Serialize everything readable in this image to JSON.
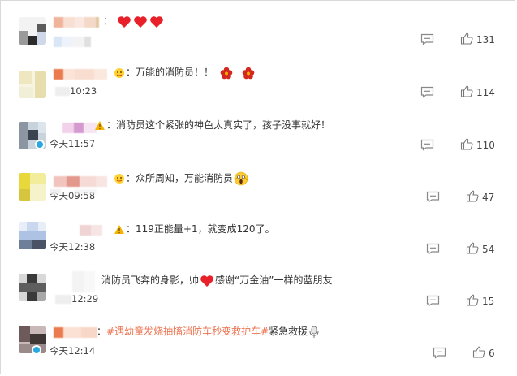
{
  "comments": [
    {
      "id": 1,
      "text_prefix": "：",
      "emojis": "heart-x3",
      "time": "",
      "likes": "131"
    },
    {
      "id": 2,
      "text": "：万能的消防员！！",
      "time": "10:23",
      "likes": "114"
    },
    {
      "id": 3,
      "text": "：消防员这个紧张的神色太真实了，孩子没事就好！",
      "time": "今天11:57",
      "likes": "110"
    },
    {
      "id": 4,
      "text": "：众所周知，万能消防员",
      "time": "今天09:58",
      "likes": "47"
    },
    {
      "id": 5,
      "text": "：119正能量+1，就变成120了。",
      "time": "今天12:38",
      "likes": "54"
    },
    {
      "id": 6,
      "text_a": "消防员飞奔的身影，帅",
      "text_b": "感谢“万金油”一样的蓝朋友",
      "time": "12:29",
      "likes": "15"
    },
    {
      "id": 7,
      "text_prefix": "：",
      "hashtag1": "#遇幼童发烧抽搐消防车秒变救护车#",
      "text_mid": "紧急救援",
      "time": "今天12:14",
      "likes": "6"
    }
  ],
  "colors": {
    "hashtag": "#eb7350",
    "verify": "#2aa7e0",
    "heart": "#e8202a"
  },
  "icons": [
    "reply-icon",
    "like-icon",
    "heart-icon",
    "flower-icon",
    "fire-badge-icon",
    "verified-icon",
    "scream-emoji-icon",
    "mic-icon"
  ]
}
